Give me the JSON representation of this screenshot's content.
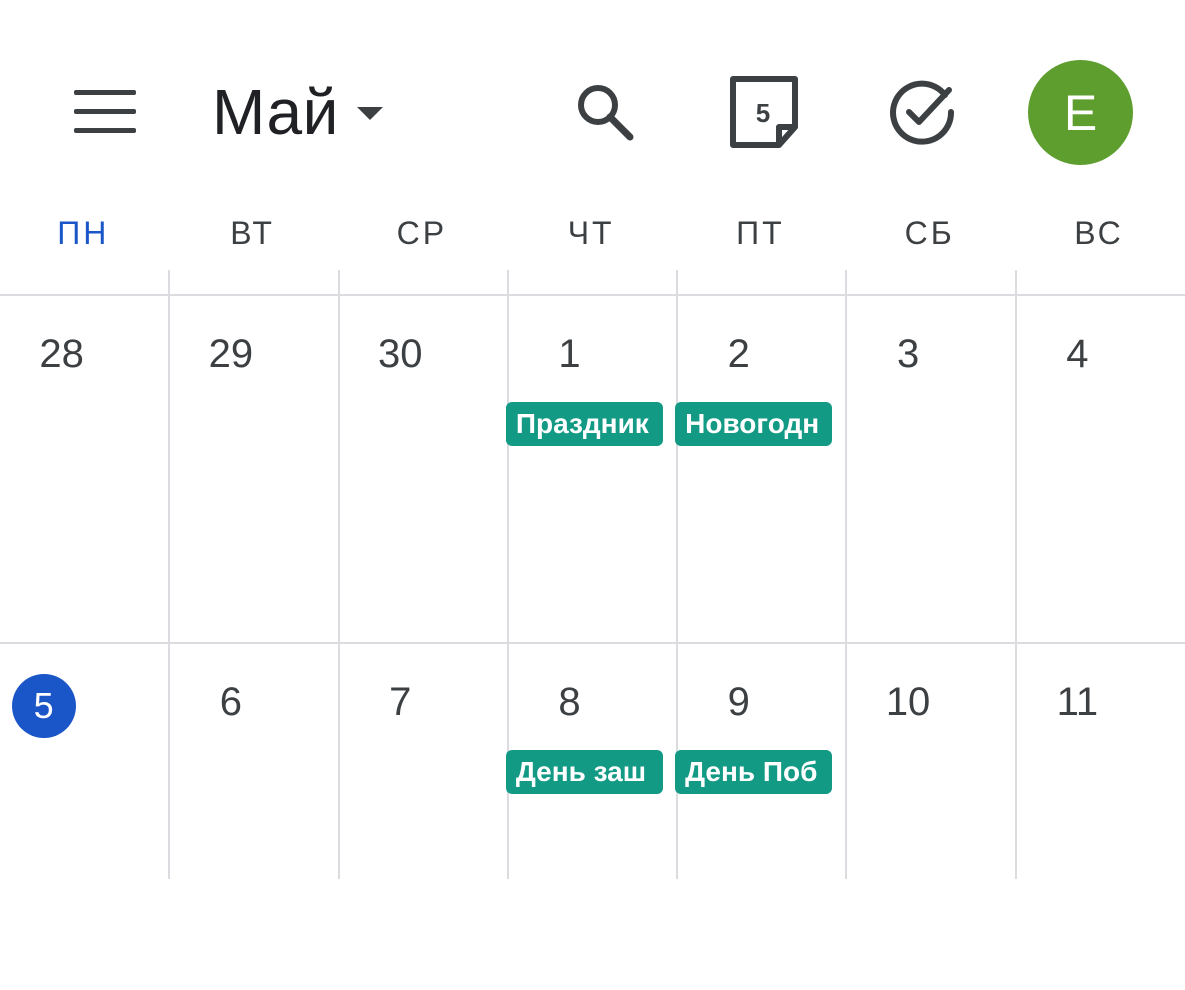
{
  "header": {
    "month_label": "Май",
    "today_icon_number": "5",
    "avatar_letter": "E",
    "avatar_color": "#5e9e2e"
  },
  "weekdays": [
    "ПН",
    "ВТ",
    "СР",
    "ЧТ",
    "ПТ",
    "СБ",
    "ВС"
  ],
  "weeks": [
    {
      "days": [
        "28",
        "29",
        "30",
        "1",
        "2",
        "3",
        "4"
      ],
      "events": [
        {
          "day_index": 3,
          "label": "Праздник"
        },
        {
          "day_index": 4,
          "label": "Новогодн"
        }
      ]
    },
    {
      "days": [
        "5",
        "6",
        "7",
        "8",
        "9",
        "10",
        "11"
      ],
      "events": [
        {
          "day_index": 3,
          "label": "День заш"
        },
        {
          "day_index": 4,
          "label": "День Поб"
        }
      ]
    }
  ],
  "today": {
    "week_index": 1,
    "day_index": 0
  },
  "colors": {
    "accent": "#1a56c8",
    "event": "#129a84",
    "grid_line": "#dadce0"
  }
}
